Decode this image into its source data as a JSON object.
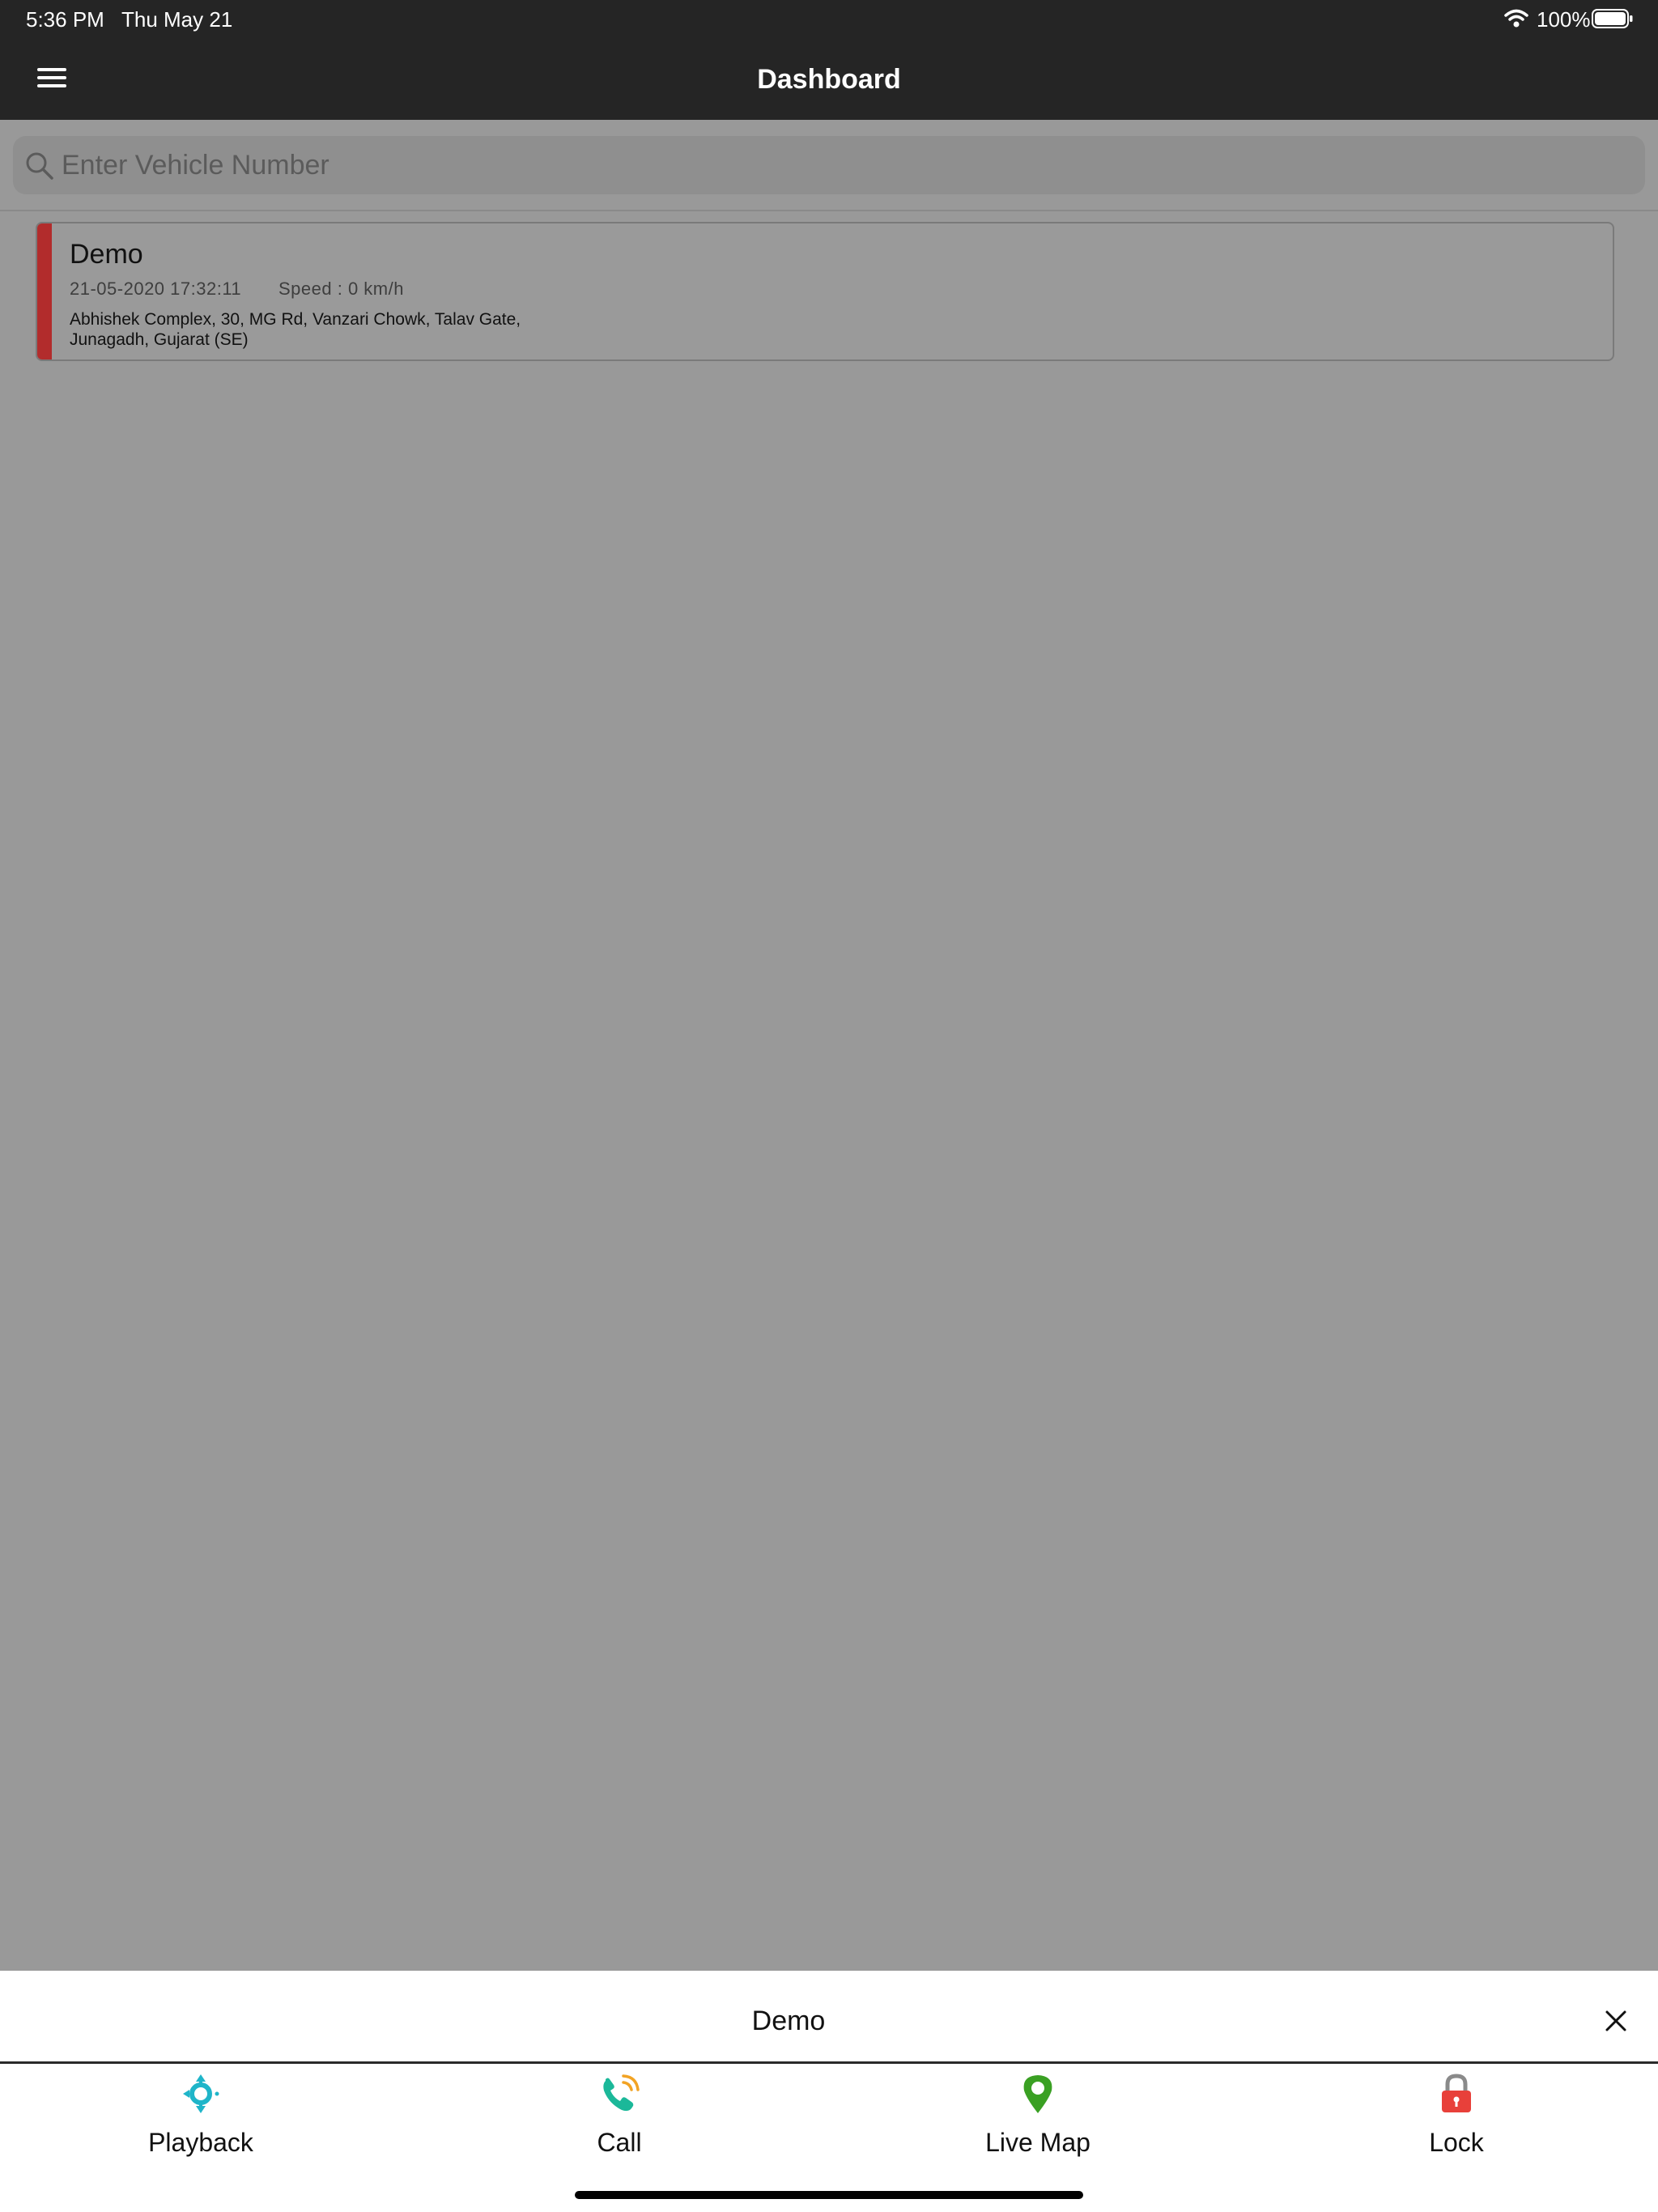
{
  "status_bar": {
    "time": "5:36 PM",
    "date": "Thu May 21",
    "battery": "100%"
  },
  "nav": {
    "title": "Dashboard",
    "menu_icon": "hamburger-menu-icon"
  },
  "search": {
    "placeholder": "Enter Vehicle Number",
    "value": ""
  },
  "vehicle_card": {
    "name": "Demo",
    "datetime": "21-05-2020 17:32:11",
    "speed": "Speed : 0 km/h",
    "address": "Abhishek Complex, 30, MG Rd, Vanzari Chowk, Talav Gate, Junagadh, Gujarat (SE)",
    "status_color": "#b22c2c"
  },
  "sheet": {
    "title": "Demo",
    "actions": [
      {
        "label": "Playback",
        "icon": "playback-icon",
        "color": "#1fb5c9"
      },
      {
        "label": "Call",
        "icon": "phone-call-icon",
        "color": "#1bb899"
      },
      {
        "label": "Live Map",
        "icon": "map-pin-icon",
        "color": "#3aa023"
      },
      {
        "label": "Lock",
        "icon": "lock-icon",
        "color": "#e8403a"
      }
    ]
  }
}
